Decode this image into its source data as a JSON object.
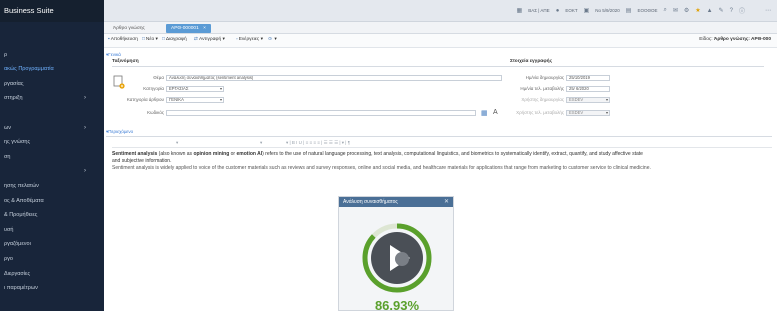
{
  "app": {
    "title": "Business Suite"
  },
  "sidebar": {
    "items": [
      {
        "label": ""
      },
      {
        "label": "ρ"
      },
      {
        "label": "ακώς Προγραμματία",
        "active": true
      },
      {
        "label": "ργασίας"
      },
      {
        "label": "στηριξη",
        "chevron": true
      },
      {
        "label": ""
      },
      {
        "label": "ων",
        "chevron": true
      },
      {
        "label": "ης γνώσης"
      },
      {
        "label": "ση"
      },
      {
        "label": "",
        "chevron": true
      },
      {
        "label": "ησης πελατών"
      },
      {
        "label": "ος & Αποθέματα"
      },
      {
        "label": "& Προμήθειες"
      },
      {
        "label": "υσή"
      },
      {
        "label": "ργαζόμενοι"
      },
      {
        "label": "ργο"
      },
      {
        "label": "Διεργασίες"
      },
      {
        "label": "ι παραμέτρων"
      }
    ]
  },
  "topbar": {
    "items": [
      "ΒΑΣ | ΑΠΕ",
      "ΕΟΚΤ",
      "Νο 5/9/2020",
      "ΕΟΟΘΟΕ"
    ]
  },
  "tabs": [
    {
      "label": "Άρθρο γνώσης"
    },
    {
      "label": "ΑΡΘ-000001",
      "close": "×"
    }
  ],
  "toolbar": {
    "save": "Αποθήκευση",
    "new": "Νέο",
    "delete": "Διαγραφή",
    "copy": "Αντιγραφή",
    "actions": "Ενέργειες",
    "type_label": "Είδος:",
    "type_value": "Άρθρο γνώσης: ΑΡΘ-000"
  },
  "general": {
    "section": "Γενικά",
    "classification": "Ταξινόμηση",
    "fields": {
      "title_label": "Θέμα",
      "title_value": "Ανάλυση συναισθήματος (sentiment analysis)",
      "category_label": "Κατηγορία",
      "category_value": "ΕΡΓΑΣΙΑΣ",
      "article_category_label": "Κατηγορία άρθρου",
      "article_category_value": "ΓΕΝΙΚΑ",
      "code_label": "Κωδικός",
      "code_value": ""
    },
    "record": {
      "title": "Στοιχεία εγγραφής",
      "created_label": "Ημ/νία δημιουργίας",
      "created_value": "25/10/2019",
      "updated_label": "Ημ/νία τελ. μεταβολής",
      "updated_value": "25/ 6/2020",
      "creator_label": "Χρήστης δημιουργίας",
      "creator_value": "ESDEV",
      "modifier_label": "Χρήστης τελ. μεταβολής",
      "modifier_value": "ESDEV"
    }
  },
  "editor": {
    "section": "Περιεχόμενο",
    "line1_a": "Sentiment analysis",
    "line1_b": " (also known as ",
    "line1_c": "opinion mining",
    "line1_d": " or ",
    "line1_e": "emotion AI",
    "line1_f": ") refers to the use of natural language processing, text analysis, computational linguistics, and biometrics to systematically identify, extract, quantify, and study affective state",
    "line2": "and subjective information.",
    "line3": "Sentiment analysis is widely applied to voice of the customer materials such as reviews and survey responses, online and social media, and healthcare materials for applications that range from marketing to customer service to clinical medicine."
  },
  "sentiment_panel": {
    "title": "Ανάλυση συναισθήματος",
    "close": "✕",
    "percent_text": "86.93%",
    "percent": 86.93,
    "color": "#5aa02c"
  }
}
